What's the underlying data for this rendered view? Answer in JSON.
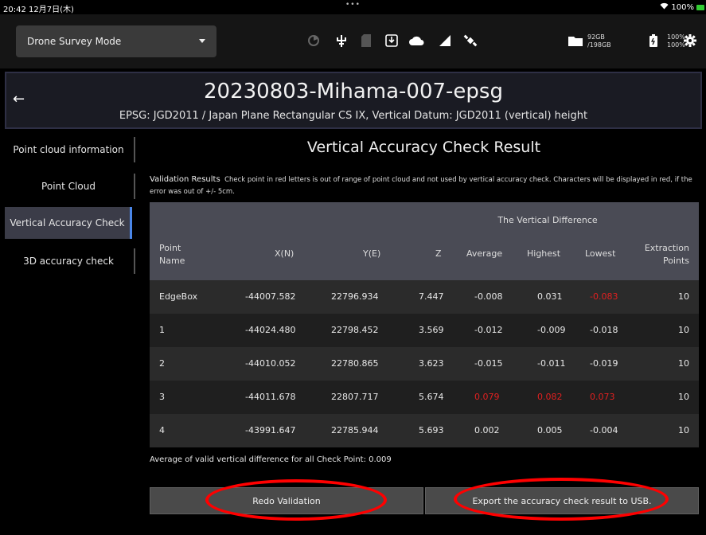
{
  "status": {
    "time": "20:42  12月7日(木)",
    "dots": "•••",
    "battery": "100%"
  },
  "toolbar": {
    "mode": "Drone Survey Mode",
    "storage_line1": "92GB",
    "storage_line2": "/198GB",
    "battery_line1": "100%",
    "battery_line2": "100%",
    "icons": [
      "gps-icon",
      "antenna-icon",
      "sd-card-icon",
      "download-icon",
      "cloud-icon",
      "signal-icon",
      "satellite-icon",
      "folder-icon",
      "battery-icon",
      "settings-icon"
    ]
  },
  "header": {
    "title": "20230803-Mihama-007-epsg",
    "subtitle": "EPSG: JGD2011 / Japan Plane Rectangular CS IX, Vertical Datum: JGD2011 (vertical) height",
    "back": "←"
  },
  "sidebar": {
    "items": [
      {
        "label": "Point cloud information"
      },
      {
        "label": "Point Cloud"
      },
      {
        "label": "Vertical Accuracy Check"
      },
      {
        "label": "3D accuracy check"
      }
    ]
  },
  "main": {
    "title": "Vertical Accuracy Check Result",
    "validation_lead": "Validation Results",
    "validation_text": "Check point in red letters is out of range of point cloud and not used by vertical accuracy check. Characters will be displayed in red, if the error was out of +/- 5cm.",
    "table": {
      "group_header": "The Vertical Difference",
      "headers": {
        "point_name": [
          "Point",
          "Name"
        ],
        "x": "X(N)",
        "y": "Y(E)",
        "z": "Z",
        "average": "Average",
        "highest": "Highest",
        "lowest": "Lowest",
        "extraction": [
          "Extraction",
          "Points"
        ]
      },
      "rows": [
        {
          "name": "EdgeBox",
          "x": "-44007.582",
          "y": "22796.934",
          "z": "7.447",
          "avg": "-0.008",
          "high": "0.031",
          "low": "-0.083",
          "pts": "10",
          "red": [
            "low"
          ]
        },
        {
          "name": "1",
          "x": "-44024.480",
          "y": "22798.452",
          "z": "3.569",
          "avg": "-0.012",
          "high": "-0.009",
          "low": "-0.018",
          "pts": "10",
          "red": []
        },
        {
          "name": "2",
          "x": "-44010.052",
          "y": "22780.865",
          "z": "3.623",
          "avg": "-0.015",
          "high": "-0.011",
          "low": "-0.019",
          "pts": "10",
          "red": []
        },
        {
          "name": "3",
          "x": "-44011.678",
          "y": "22807.717",
          "z": "5.674",
          "avg": "0.079",
          "high": "0.082",
          "low": "0.073",
          "pts": "10",
          "red": [
            "avg",
            "high",
            "low"
          ]
        },
        {
          "name": "4",
          "x": "-43991.647",
          "y": "22785.944",
          "z": "5.693",
          "avg": "0.002",
          "high": "0.005",
          "low": "-0.004",
          "pts": "10",
          "red": []
        }
      ]
    },
    "average_text": "Average of valid vertical difference for all Check Point: 0.009",
    "redo_label": "Redo Validation",
    "export_label": "Export the accuracy check result to USB.",
    "highlight_color": "#ff0000"
  }
}
